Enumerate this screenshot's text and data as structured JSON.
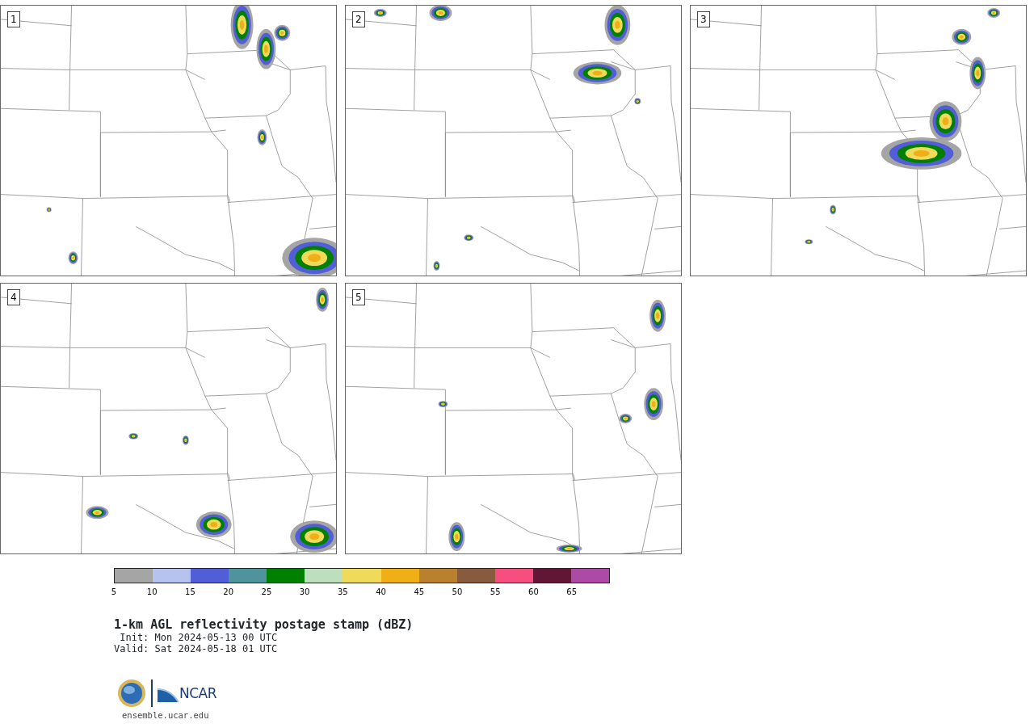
{
  "panels": [
    {
      "label": "1"
    },
    {
      "label": "2"
    },
    {
      "label": "3"
    },
    {
      "label": "4"
    },
    {
      "label": "5"
    }
  ],
  "colorbar": {
    "bins": [
      {
        "color": "#a5a5a5"
      },
      {
        "color": "#b7c3ef"
      },
      {
        "color": "#525ed8"
      },
      {
        "color": "#4f949c"
      },
      {
        "color": "#008001"
      },
      {
        "color": "#bedfbe"
      },
      {
        "color": "#f0da5a"
      },
      {
        "color": "#f0ae17"
      },
      {
        "color": "#b9812e"
      },
      {
        "color": "#895b3e"
      },
      {
        "color": "#f64f7e"
      },
      {
        "color": "#621636"
      },
      {
        "color": "#ad4aa6"
      }
    ],
    "ticks": [
      "5",
      "10",
      "15",
      "20",
      "25",
      "30",
      "35",
      "40",
      "45",
      "50",
      "55",
      "60",
      "65"
    ]
  },
  "title": "1-km AGL reflectivity postage stamp (dBZ)",
  "init": " Init: Mon 2024-05-13 00 UTC",
  "valid": "Valid: Sat 2024-05-18 01 UTC",
  "logo": {
    "text": "NCAR",
    "url": "ensemble.ucar.edu"
  }
}
